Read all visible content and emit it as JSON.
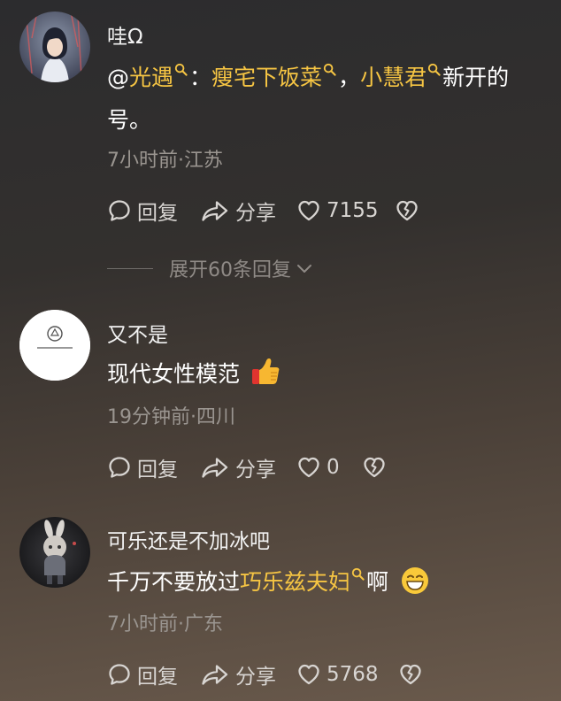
{
  "comments": [
    {
      "author": "哇Ω",
      "body": {
        "prefix": "@",
        "link1": "光遇",
        "sep1": "：",
        "link2": "瘦宅下饭菜",
        "sep2": "，",
        "link3": "小慧君",
        "suffix_line1": "新开的",
        "line2": "号。"
      },
      "meta": "7小时前·江苏",
      "reply_label": "回复",
      "share_label": "分享",
      "likes": "7155"
    },
    {
      "author": "又不是",
      "body": {
        "text": "现代女性模范"
      },
      "meta": "19分钟前·四川",
      "reply_label": "回复",
      "share_label": "分享",
      "likes": "0"
    },
    {
      "author": "可乐还是不加冰吧",
      "body": {
        "text_before": "千万不要放过",
        "link": "巧乐兹夫妇",
        "text_after": "啊"
      },
      "meta": "7小时前·广东",
      "reply_label": "回复",
      "share_label": "分享",
      "likes": "5768"
    }
  ],
  "expand_replies": "展开60条回复",
  "icons": {
    "reply": "comment-bubble-icon",
    "share": "share-arrow-icon",
    "like": "heart-icon",
    "dislike": "broken-heart-icon",
    "search": "search-icon",
    "thumbs_up_emoji": "thumbs-up-emoji",
    "grin_emoji": "grinning-face-emoji",
    "chevron": "chevron-down-icon"
  },
  "colors": {
    "highlight": "#f6c543",
    "meta": "#9a9590",
    "text": "#ffffff"
  }
}
